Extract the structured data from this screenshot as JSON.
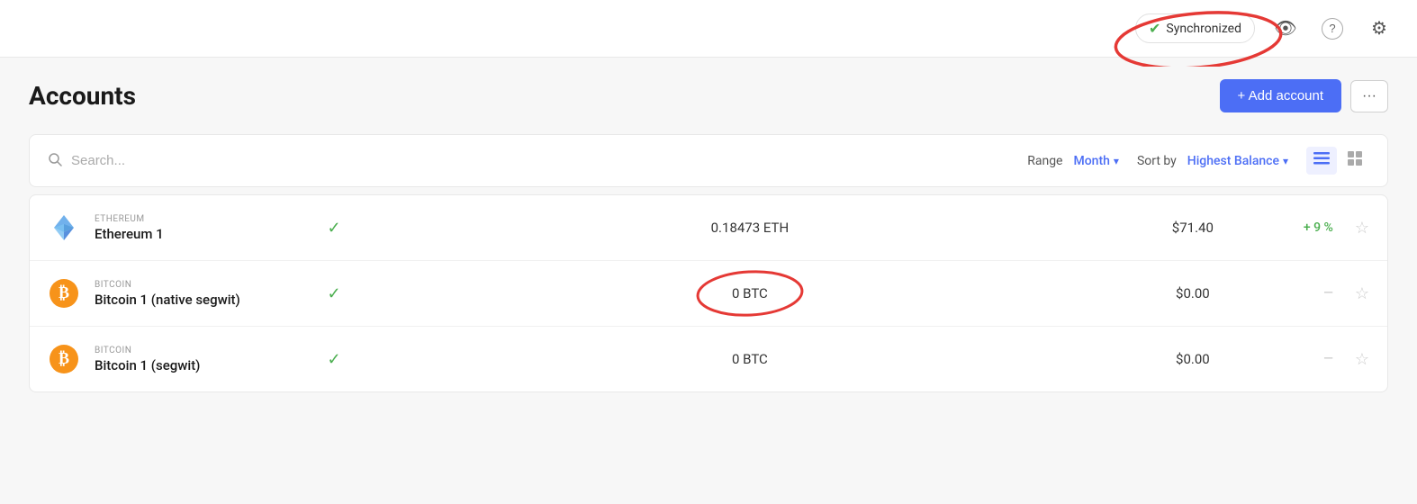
{
  "topbar": {
    "sync_label": "Synchronized",
    "eye_icon": "👁",
    "help_icon": "?",
    "settings_icon": "⚙"
  },
  "header": {
    "title": "Accounts",
    "add_button_label": "+ Add account",
    "more_button_label": "···"
  },
  "toolbar": {
    "search_placeholder": "Search...",
    "range_label": "Range",
    "range_value": "Month",
    "sort_label": "Sort by",
    "sort_value": "Highest Balance"
  },
  "view_toggles": {
    "list_icon": "≡",
    "grid_icon": "⊞"
  },
  "accounts": [
    {
      "id": "eth1",
      "coin": "ETHEREUM",
      "name": "Ethereum 1",
      "icon_type": "eth",
      "synced": true,
      "balance_crypto": "0.18473 ETH",
      "balance_fiat": "$71.40",
      "change": "+ 9 %",
      "change_type": "positive",
      "annotated": false
    },
    {
      "id": "btc1",
      "coin": "BITCOIN",
      "name": "Bitcoin 1 (native segwit)",
      "icon_type": "btc",
      "synced": true,
      "balance_crypto": "0 BTC",
      "balance_fiat": "$0.00",
      "change": "—",
      "change_type": "neutral",
      "annotated": true
    },
    {
      "id": "btc2",
      "coin": "BITCOIN",
      "name": "Bitcoin 1 (segwit)",
      "icon_type": "btc",
      "synced": true,
      "balance_crypto": "0 BTC",
      "balance_fiat": "$0.00",
      "change": "—",
      "change_type": "neutral",
      "annotated": false
    }
  ]
}
